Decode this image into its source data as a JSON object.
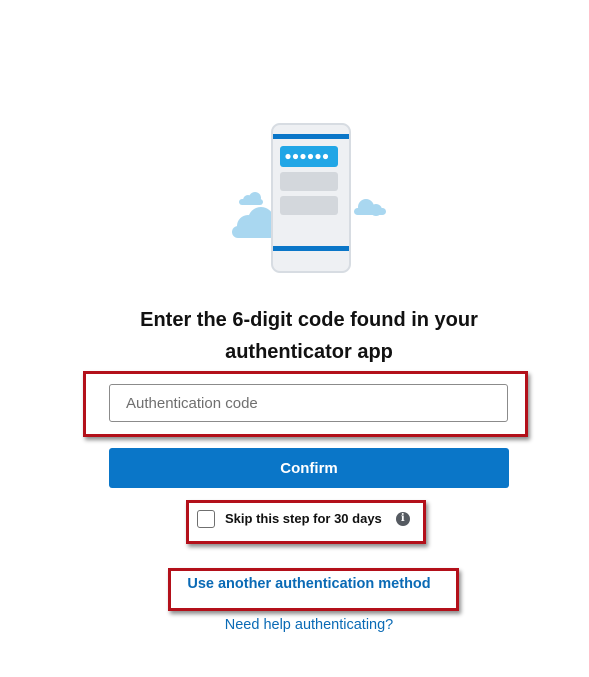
{
  "heading": {
    "line1": "Enter the 6-digit code found in your",
    "line2": "authenticator app"
  },
  "code_input": {
    "placeholder": "Authentication code",
    "value": ""
  },
  "confirm_button": {
    "label": "Confirm"
  },
  "skip": {
    "label": "Skip this step for 30 days",
    "checked": false,
    "info_icon": "info-icon"
  },
  "links": {
    "other_method": "Use another authentication method",
    "help": "Need help authenticating?"
  },
  "illustration": {
    "icon": "phone-with-password-icon",
    "accent_color": "#0a76c8",
    "cloud_color": "#a9d7f0"
  },
  "colors": {
    "primary": "#0a76c8",
    "link": "#0a6ab5",
    "highlight_border": "#b3101a"
  }
}
